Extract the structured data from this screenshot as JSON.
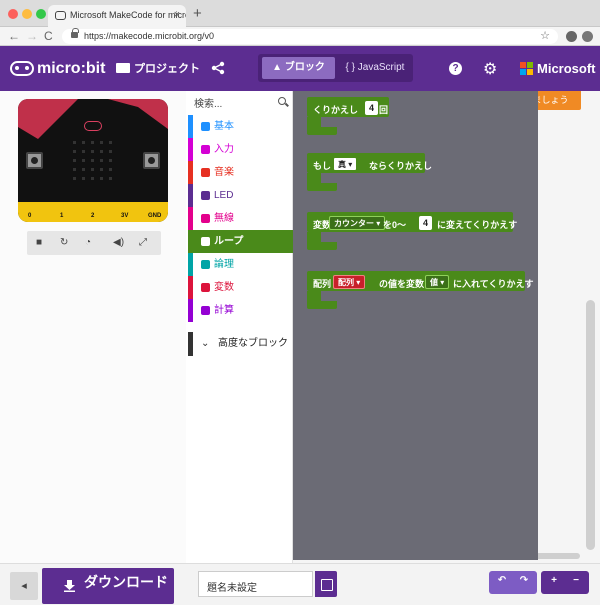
{
  "browser": {
    "tab_title": "Microsoft MakeCode for micro:",
    "tab_close": "×",
    "new_tab": "+",
    "back": "←",
    "forward": "→",
    "reload": "C",
    "url": "https://makecode.microbit.org/v0",
    "star": "☆"
  },
  "header": {
    "logo_text": "micro:bit",
    "projects_label": "プロジェクト",
    "mode_blocks": "ブロック",
    "mode_js": "{ } JavaScript",
    "help": "?",
    "gear": "⚙",
    "brand": "Microsoft"
  },
  "simulator": {
    "pins": [
      "0",
      "1",
      "2",
      "3V",
      "GND"
    ],
    "controls": [
      "■",
      "↻",
      "◔",
      "◀)",
      "⤢"
    ]
  },
  "toolbox": {
    "search_placeholder": "検索...",
    "categories": [
      {
        "label": "基本",
        "color": "#1E90FF"
      },
      {
        "label": "入力",
        "color": "#D400D4"
      },
      {
        "label": "音楽",
        "color": "#E63022"
      },
      {
        "label": "LED",
        "color": "#5C2D91"
      },
      {
        "label": "無線",
        "color": "#E3008C"
      },
      {
        "label": "ループ",
        "color": "#00AA00"
      },
      {
        "label": "論理",
        "color": "#00A4A6"
      },
      {
        "label": "変数",
        "color": "#DC143C"
      },
      {
        "label": "計算",
        "color": "#9400D3"
      }
    ],
    "advanced": "高度なブロック"
  },
  "workspace": {
    "start_button": "はじめましょう",
    "blocks": {
      "repeat": {
        "prefix": "くりかえし",
        "count": "4",
        "suffix": "回"
      },
      "while": {
        "prefix": "もし",
        "cond": "真 ▾",
        "suffix": "ならくりかえし"
      },
      "for": {
        "prefix": "変数",
        "var": "カウンター ▾",
        "mid": "を0〜",
        "count": "4",
        "suffix": "に変えてくりかえす"
      },
      "foreach": {
        "prefix": "配列",
        "arr": "配列 ▾",
        "mid": "の値を変数",
        "var": "値 ▾",
        "suffix": "に入れてくりかえす"
      }
    }
  },
  "footer": {
    "download": "ダウンロード",
    "project_name": "題名未設定",
    "undo": "↶",
    "redo": "↷",
    "zoom_in": "+",
    "zoom_out": "−"
  }
}
